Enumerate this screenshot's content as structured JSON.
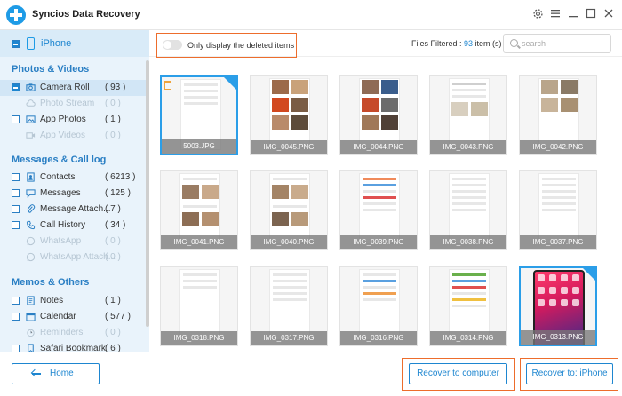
{
  "app": {
    "title": "Syncios Data Recovery"
  },
  "window": {
    "settings_icon": "gear-icon",
    "menu_icon": "hamburger-icon"
  },
  "device": {
    "name": "iPhone"
  },
  "sidebar": {
    "groups": [
      {
        "title": "Photos & Videos",
        "items": [
          {
            "label": "Camera Roll",
            "count": "( 93 )",
            "icon": "camera-icon",
            "state": "selected"
          },
          {
            "label": "Photo Stream",
            "count": "( 0 )",
            "icon": "cloud-icon",
            "state": "disabled"
          },
          {
            "label": "App Photos",
            "count": "( 1 )",
            "icon": "image-icon",
            "state": "normal"
          },
          {
            "label": "App Videos",
            "count": "( 0 )",
            "icon": "video-icon",
            "state": "disabled"
          }
        ]
      },
      {
        "title": "Messages & Call log",
        "items": [
          {
            "label": "Contacts",
            "count": "( 6213 )",
            "icon": "contact-icon",
            "state": "normal"
          },
          {
            "label": "Messages",
            "count": "( 125 )",
            "icon": "message-icon",
            "state": "normal"
          },
          {
            "label": "Message Attach...",
            "count": "( 7 )",
            "icon": "paperclip-icon",
            "state": "normal"
          },
          {
            "label": "Call History",
            "count": "( 34 )",
            "icon": "phone-icon",
            "state": "normal"
          },
          {
            "label": "WhatsApp",
            "count": "( 0 )",
            "icon": "whatsapp-icon",
            "state": "disabled"
          },
          {
            "label": "WhatsApp Attach...",
            "count": "( 0 )",
            "icon": "whatsapp-icon",
            "state": "disabled"
          }
        ]
      },
      {
        "title": "Memos & Others",
        "items": [
          {
            "label": "Notes",
            "count": "( 1 )",
            "icon": "note-icon",
            "state": "normal"
          },
          {
            "label": "Calendar",
            "count": "( 577 )",
            "icon": "calendar-icon",
            "state": "normal"
          },
          {
            "label": "Reminders",
            "count": "( 0 )",
            "icon": "reminder-icon",
            "state": "disabled"
          },
          {
            "label": "Safari Bookmark",
            "count": "( 6 )",
            "icon": "bookmark-icon",
            "state": "normal"
          }
        ]
      }
    ]
  },
  "toolbar": {
    "toggle_label": "Only display the deleted items",
    "filtered_prefix": "Files Filtered : ",
    "filtered_count": "93",
    "filtered_suffix": " item (s)",
    "search_placeholder": "search"
  },
  "grid": {
    "rows": [
      [
        "5003.JPG",
        "IMG_0045.PNG",
        "IMG_0044.PNG",
        "IMG_0043.PNG",
        "IMG_0042.PNG"
      ],
      [
        "IMG_0041.PNG",
        "IMG_0040.PNG",
        "IMG_0039.PNG",
        "IMG_0038.PNG",
        "IMG_0037.PNG"
      ],
      [
        "IMG_0318.PNG",
        "IMG_0317.PNG",
        "IMG_0316.PNG",
        "IMG_0314.PNG",
        "IMG_0313.PNG"
      ]
    ],
    "selected": [
      "5003.JPG",
      "IMG_0313.PNG"
    ]
  },
  "footer": {
    "home_label": "Home",
    "recover_computer_label": "Recover to computer",
    "recover_device_label": "Recover to: iPhone"
  },
  "colors": {
    "accent": "#1e86d0",
    "highlight": "#ed6d2c",
    "sidebar_bg": "#e9f3fb"
  }
}
